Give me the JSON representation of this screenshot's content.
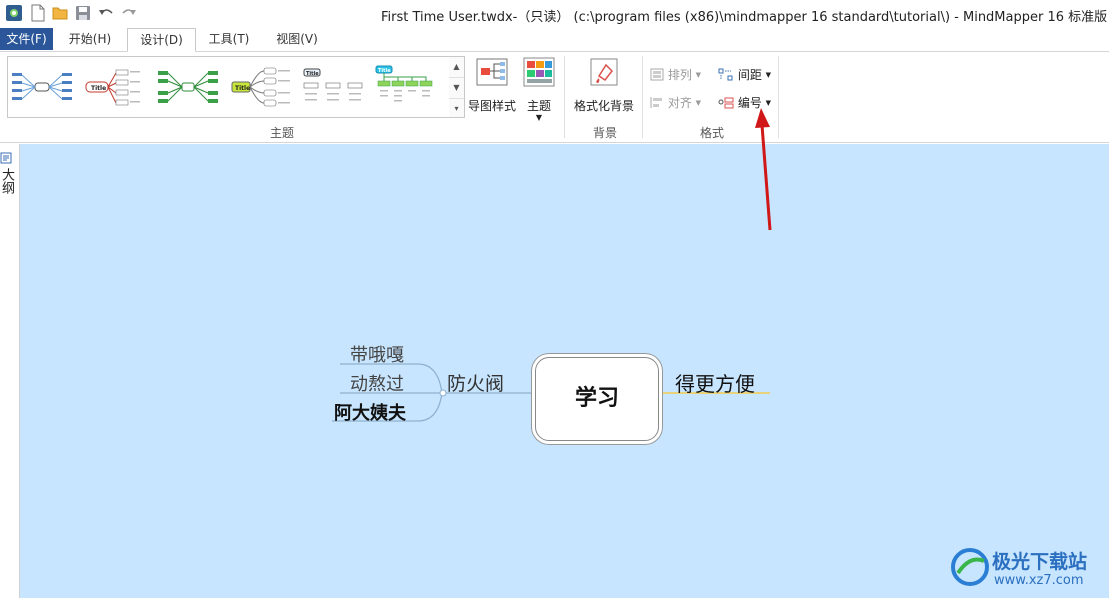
{
  "window": {
    "title": "First Time User.twdx-（只读） (c:\\program files (x86)\\mindmapper 16 standard\\tutorial\\) - MindMapper 16 标准版"
  },
  "quick_access": {
    "icons": [
      "app-icon",
      "new-file-icon",
      "open-folder-icon",
      "save-icon",
      "undo-icon",
      "redo-icon"
    ]
  },
  "tabs": [
    {
      "label": "文件(F)"
    },
    {
      "label": "开始(H)"
    },
    {
      "label": "设计(D)"
    },
    {
      "label": "工具(T)"
    },
    {
      "label": "视图(V)"
    }
  ],
  "ribbon": {
    "theme_group_label": "主题",
    "map_style_label": "导图样式",
    "theme_label": "主题",
    "format_bg_label": "格式化背景",
    "background_group_label": "背景",
    "arrange_label": "排列",
    "align_label": "对齐",
    "spacing_label": "间距",
    "numbering_label": "编号",
    "format_group_label": "格式",
    "thumb_title_a": "Title",
    "thumb_title_b": "Title",
    "thumb_title_c": "Title",
    "thumb_title_d": "Title"
  },
  "side_panel": {
    "outline_label": "大纲"
  },
  "mindmap": {
    "central": "学习",
    "right_topic": "得更方便",
    "left_topic": "防火阀",
    "subtopics": [
      "带哦嘎",
      "动熬过",
      "阿大姨夫"
    ]
  },
  "watermark": {
    "name": "极光下载站",
    "url": "www.xz7.com"
  },
  "colors": {
    "file_tab": "#2b579a",
    "canvas": "#c7e5fe",
    "arrow": "#d01818",
    "right_underline": "#e8d27a"
  }
}
